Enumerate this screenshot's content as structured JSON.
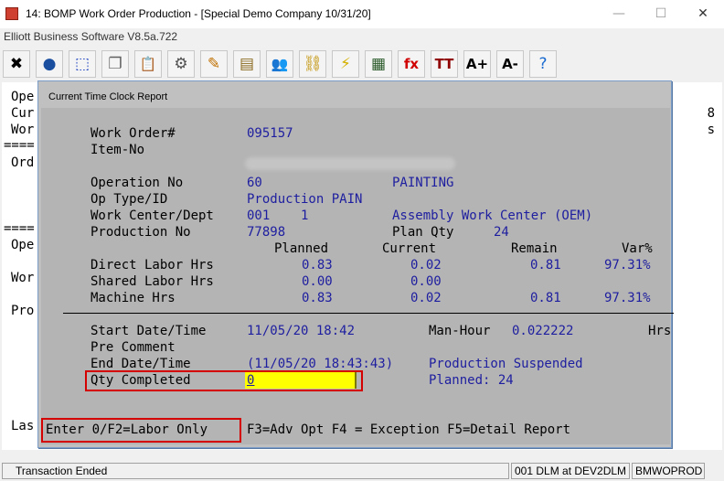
{
  "window": {
    "title": "14: BOMP Work Order Production - [Special Demo Company 10/31/20]",
    "subtitle": "Elliott Business Software V8.5a.722",
    "minimize": "—",
    "maximize": "☐",
    "close": "✕"
  },
  "toolbar": {
    "buttons": [
      {
        "name": "close-tool-icon",
        "glyph": "✖",
        "color": "#000000"
      },
      {
        "name": "globe-icon",
        "glyph": "●",
        "color": "#1a4fa0"
      },
      {
        "name": "select-icon",
        "glyph": "⬚",
        "color": "#1a3fbf"
      },
      {
        "name": "copy-icon",
        "glyph": "❐",
        "color": "#606060"
      },
      {
        "name": "paste-icon",
        "glyph": "📋",
        "color": "#806020"
      },
      {
        "name": "settings-icon",
        "glyph": "⚙",
        "color": "#505050"
      },
      {
        "name": "edit-icon",
        "glyph": "✎",
        "color": "#c07000"
      },
      {
        "name": "notes-icon",
        "glyph": "▤",
        "color": "#8a6a20"
      },
      {
        "name": "users-icon",
        "glyph": "👥",
        "color": "#2a6a2a"
      },
      {
        "name": "link-icon",
        "glyph": "⛓",
        "color": "#c09000"
      },
      {
        "name": "lightning-icon",
        "glyph": "⚡",
        "color": "#d4b000"
      },
      {
        "name": "report-icon",
        "glyph": "▦",
        "color": "#2a5a2a"
      },
      {
        "name": "function-icon",
        "glyph": "fx",
        "color": "#d00000"
      },
      {
        "name": "font-icon",
        "glyph": "TT",
        "color": "#900000"
      },
      {
        "name": "font-increase-icon",
        "glyph": "A+",
        "color": "#000000"
      },
      {
        "name": "font-decrease-icon",
        "glyph": "A-",
        "color": "#000000"
      },
      {
        "name": "help-icon",
        "glyph": "?",
        "color": "#1a6ad0"
      }
    ]
  },
  "background": {
    "lines_left": [
      "Ope",
      "Cur",
      "Wor",
      "====",
      "Ord",
      "====",
      "Ope",
      "Wor",
      "Pro",
      "Las"
    ],
    "right_8": "8",
    "right_s": "s"
  },
  "dialog": {
    "title": "Current Time Clock Report",
    "work_order_label": "Work Order#",
    "work_order_value": "095157",
    "item_no_label": "Item-No",
    "operation_no_label": "Operation No",
    "operation_no_value": "60",
    "operation_desc": "PAINTING",
    "op_type_label": "Op Type/ID",
    "op_type_value": "Production PAIN",
    "work_center_label": "Work Center/Dept",
    "work_center_value": "001    1",
    "work_center_desc": "Assembly Work Center (OEM)",
    "production_no_label": "Production No",
    "production_no_value": "77898",
    "plan_qty_label": "Plan Qty",
    "plan_qty_value": "24",
    "col_planned": "Planned",
    "col_current": "Current",
    "col_remain": "Remain",
    "col_var": "Var%",
    "direct_labor_label": "Direct Labor Hrs",
    "direct_labor_planned": "0.83",
    "direct_labor_current": "0.02",
    "direct_labor_remain": "0.81",
    "direct_labor_var": "97.31%",
    "shared_labor_label": "Shared Labor Hrs",
    "shared_labor_planned": "0.00",
    "shared_labor_current": "0.00",
    "machine_label": "Machine Hrs",
    "machine_planned": "0.83",
    "machine_current": "0.02",
    "machine_remain": "0.81",
    "machine_var": "97.31%",
    "start_label": "Start Date/Time",
    "start_value": "11/05/20 18:42",
    "man_hour_label": "Man-Hour",
    "man_hour_value": "0.022222",
    "hrs_label": "Hrs",
    "pre_comment_label": "Pre Comment",
    "end_label": "End Date/Time",
    "end_value": "(11/05/20 18:43:43)",
    "end_status": "Production Suspended",
    "qty_completed_label": "Qty Completed",
    "qty_completed_value": "0",
    "planned_label": "Planned: 24",
    "prompt_enter": "Enter 0/F2=Labor Only",
    "prompt_rest": "F3=Adv Opt F4 = Exception F5=Detail Report"
  },
  "statusbar": {
    "message": "Transaction Ended",
    "user": "001 DLM at DEV2DLM",
    "program": "BMWOPROD"
  }
}
